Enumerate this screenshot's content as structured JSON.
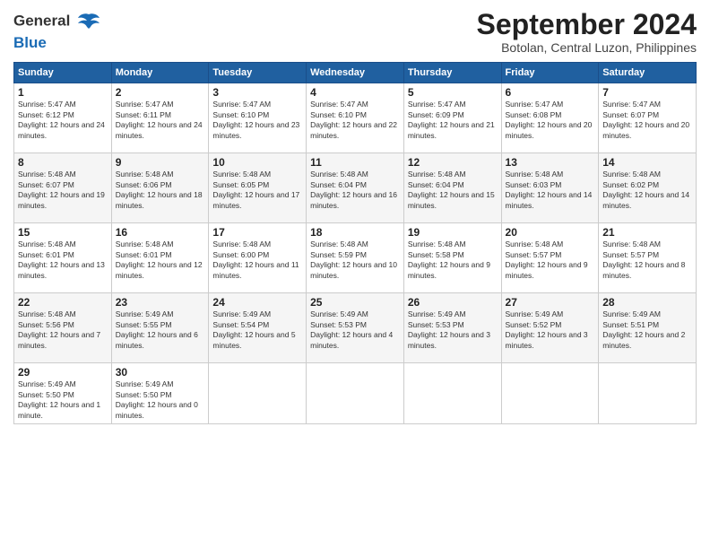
{
  "header": {
    "logo_line1": "General",
    "logo_line2": "Blue",
    "month_title": "September 2024",
    "location": "Botolan, Central Luzon, Philippines"
  },
  "weekdays": [
    "Sunday",
    "Monday",
    "Tuesday",
    "Wednesday",
    "Thursday",
    "Friday",
    "Saturday"
  ],
  "weeks": [
    [
      {
        "day": "1",
        "sunrise": "5:47 AM",
        "sunset": "6:12 PM",
        "daylight": "12 hours and 24 minutes."
      },
      {
        "day": "2",
        "sunrise": "5:47 AM",
        "sunset": "6:11 PM",
        "daylight": "12 hours and 24 minutes."
      },
      {
        "day": "3",
        "sunrise": "5:47 AM",
        "sunset": "6:10 PM",
        "daylight": "12 hours and 23 minutes."
      },
      {
        "day": "4",
        "sunrise": "5:47 AM",
        "sunset": "6:10 PM",
        "daylight": "12 hours and 22 minutes."
      },
      {
        "day": "5",
        "sunrise": "5:47 AM",
        "sunset": "6:09 PM",
        "daylight": "12 hours and 21 minutes."
      },
      {
        "day": "6",
        "sunrise": "5:47 AM",
        "sunset": "6:08 PM",
        "daylight": "12 hours and 20 minutes."
      },
      {
        "day": "7",
        "sunrise": "5:47 AM",
        "sunset": "6:07 PM",
        "daylight": "12 hours and 20 minutes."
      }
    ],
    [
      {
        "day": "8",
        "sunrise": "5:48 AM",
        "sunset": "6:07 PM",
        "daylight": "12 hours and 19 minutes."
      },
      {
        "day": "9",
        "sunrise": "5:48 AM",
        "sunset": "6:06 PM",
        "daylight": "12 hours and 18 minutes."
      },
      {
        "day": "10",
        "sunrise": "5:48 AM",
        "sunset": "6:05 PM",
        "daylight": "12 hours and 17 minutes."
      },
      {
        "day": "11",
        "sunrise": "5:48 AM",
        "sunset": "6:04 PM",
        "daylight": "12 hours and 16 minutes."
      },
      {
        "day": "12",
        "sunrise": "5:48 AM",
        "sunset": "6:04 PM",
        "daylight": "12 hours and 15 minutes."
      },
      {
        "day": "13",
        "sunrise": "5:48 AM",
        "sunset": "6:03 PM",
        "daylight": "12 hours and 14 minutes."
      },
      {
        "day": "14",
        "sunrise": "5:48 AM",
        "sunset": "6:02 PM",
        "daylight": "12 hours and 14 minutes."
      }
    ],
    [
      {
        "day": "15",
        "sunrise": "5:48 AM",
        "sunset": "6:01 PM",
        "daylight": "12 hours and 13 minutes."
      },
      {
        "day": "16",
        "sunrise": "5:48 AM",
        "sunset": "6:01 PM",
        "daylight": "12 hours and 12 minutes."
      },
      {
        "day": "17",
        "sunrise": "5:48 AM",
        "sunset": "6:00 PM",
        "daylight": "12 hours and 11 minutes."
      },
      {
        "day": "18",
        "sunrise": "5:48 AM",
        "sunset": "5:59 PM",
        "daylight": "12 hours and 10 minutes."
      },
      {
        "day": "19",
        "sunrise": "5:48 AM",
        "sunset": "5:58 PM",
        "daylight": "12 hours and 9 minutes."
      },
      {
        "day": "20",
        "sunrise": "5:48 AM",
        "sunset": "5:57 PM",
        "daylight": "12 hours and 9 minutes."
      },
      {
        "day": "21",
        "sunrise": "5:48 AM",
        "sunset": "5:57 PM",
        "daylight": "12 hours and 8 minutes."
      }
    ],
    [
      {
        "day": "22",
        "sunrise": "5:48 AM",
        "sunset": "5:56 PM",
        "daylight": "12 hours and 7 minutes."
      },
      {
        "day": "23",
        "sunrise": "5:49 AM",
        "sunset": "5:55 PM",
        "daylight": "12 hours and 6 minutes."
      },
      {
        "day": "24",
        "sunrise": "5:49 AM",
        "sunset": "5:54 PM",
        "daylight": "12 hours and 5 minutes."
      },
      {
        "day": "25",
        "sunrise": "5:49 AM",
        "sunset": "5:53 PM",
        "daylight": "12 hours and 4 minutes."
      },
      {
        "day": "26",
        "sunrise": "5:49 AM",
        "sunset": "5:53 PM",
        "daylight": "12 hours and 3 minutes."
      },
      {
        "day": "27",
        "sunrise": "5:49 AM",
        "sunset": "5:52 PM",
        "daylight": "12 hours and 3 minutes."
      },
      {
        "day": "28",
        "sunrise": "5:49 AM",
        "sunset": "5:51 PM",
        "daylight": "12 hours and 2 minutes."
      }
    ],
    [
      {
        "day": "29",
        "sunrise": "5:49 AM",
        "sunset": "5:50 PM",
        "daylight": "12 hours and 1 minute."
      },
      {
        "day": "30",
        "sunrise": "5:49 AM",
        "sunset": "5:50 PM",
        "daylight": "12 hours and 0 minutes."
      },
      null,
      null,
      null,
      null,
      null
    ]
  ]
}
